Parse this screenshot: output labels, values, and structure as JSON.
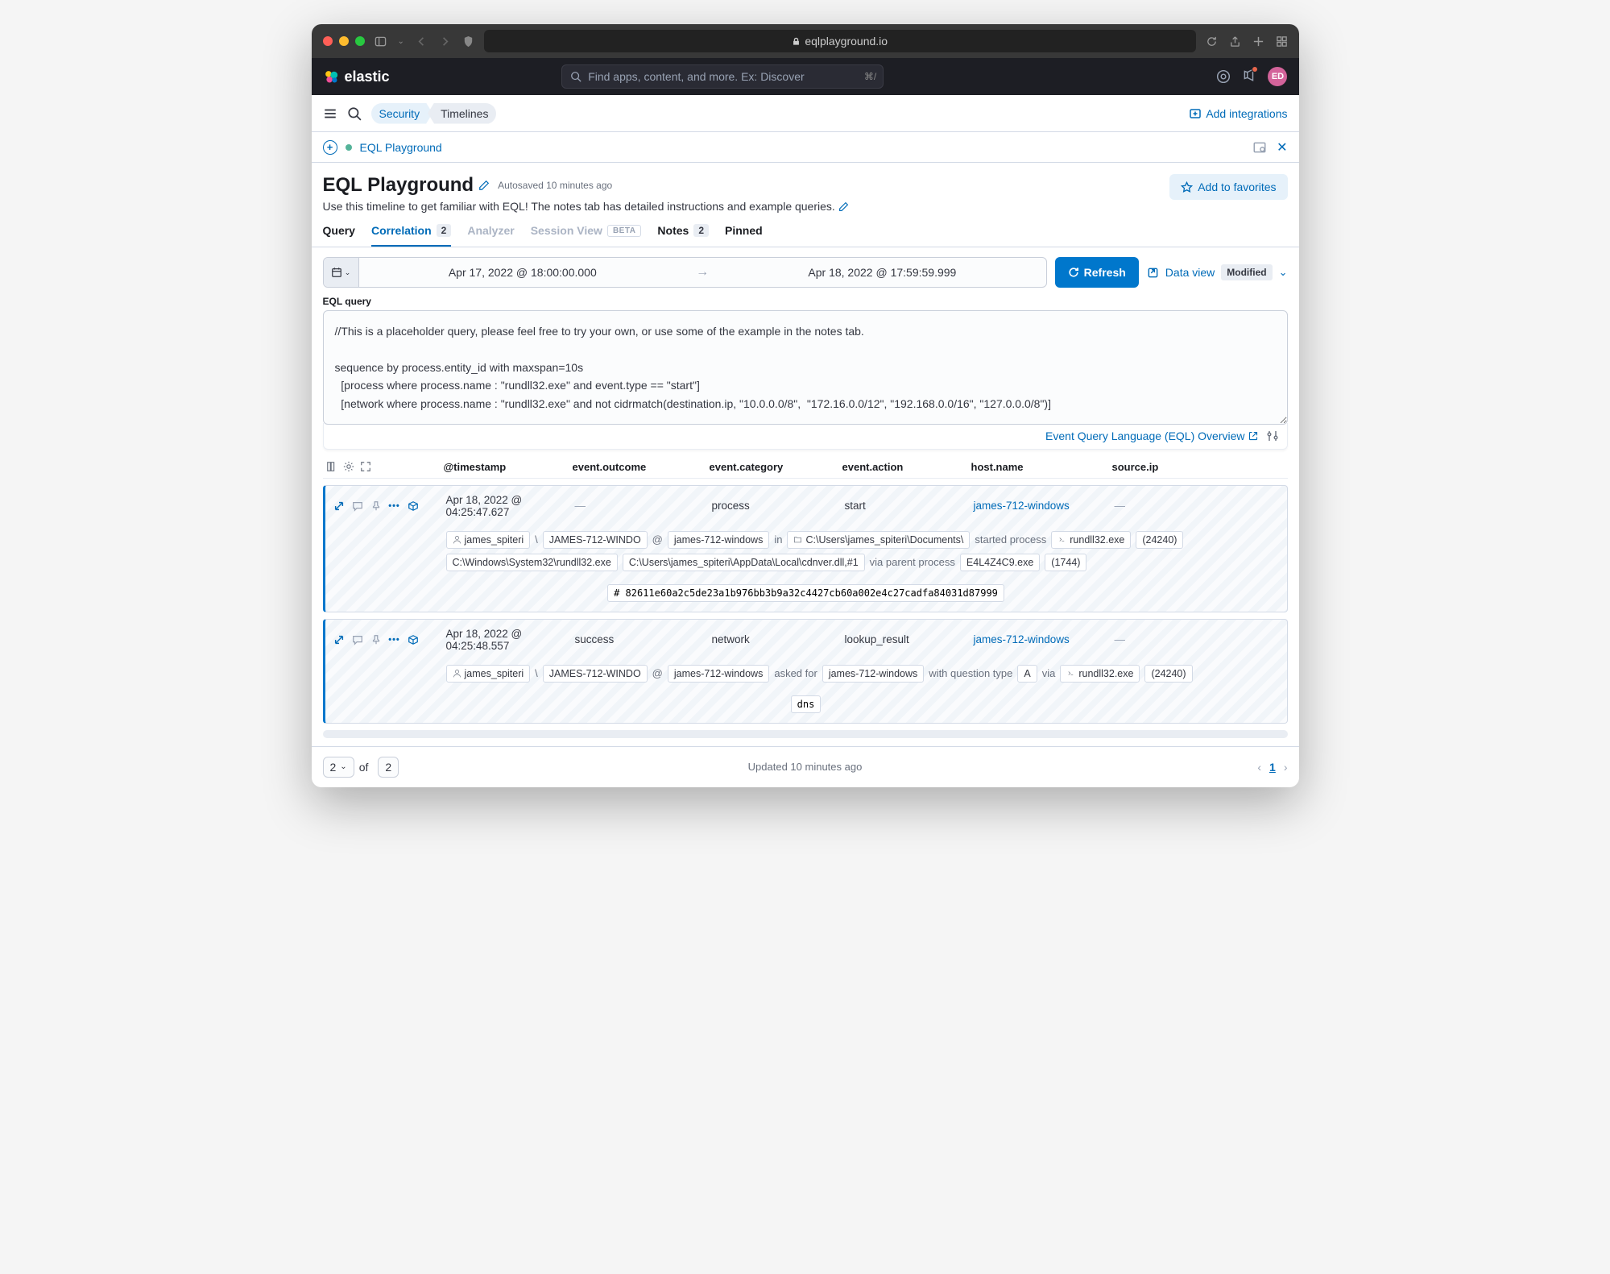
{
  "browser": {
    "url_host": "eqlplayground.io"
  },
  "header": {
    "search_placeholder": "Find apps, content, and more. Ex: Discover",
    "search_shortcut": "⌘/",
    "avatar_initials": "ED",
    "logo_text": "elastic"
  },
  "breadcrumbs": {
    "security": "Security",
    "timelines": "Timelines",
    "add_integrations": "Add integrations"
  },
  "timeline_bar": {
    "name": "EQL Playground"
  },
  "title": {
    "heading": "EQL Playground",
    "autosaved": "Autosaved 10 minutes ago",
    "subtitle": "Use this timeline to get familiar with EQL! The notes tab has detailed instructions and example queries.",
    "favorite": "Add to favorites"
  },
  "tabs": {
    "query": "Query",
    "correlation": "Correlation",
    "correlation_count": "2",
    "analyzer": "Analyzer",
    "session_view": "Session View",
    "session_badge": "BETA",
    "notes": "Notes",
    "notes_count": "2",
    "pinned": "Pinned"
  },
  "querybar": {
    "from": "Apr 17, 2022 @ 18:00:00.000",
    "to": "Apr 18, 2022 @ 17:59:59.999",
    "refresh": "Refresh",
    "data_view": "Data view",
    "modified": "Modified"
  },
  "eql": {
    "label": "EQL query",
    "text": "//This is a placeholder query, please feel free to try your own, or use some of the example in the notes tab.\n\nsequence by process.entity_id with maxspan=10s\n  [process where process.name : \"rundll32.exe\" and event.type == \"start\"]\n  [network where process.name : \"rundll32.exe\" and not cidrmatch(destination.ip, \"10.0.0.0/8\",  \"172.16.0.0/12\", \"192.168.0.0/16\", \"127.0.0.0/8\")]",
    "overview_link": "Event Query Language (EQL) Overview"
  },
  "columns": {
    "timestamp": "@timestamp",
    "outcome": "event.outcome",
    "category": "event.category",
    "action": "event.action",
    "host": "host.name",
    "sourceip": "source.ip"
  },
  "row1": {
    "timestamp": "Apr 18, 2022 @ 04:25:47.627",
    "outcome": "—",
    "category": "process",
    "action": "start",
    "host": "james-712-windows",
    "sourceip": "—",
    "user": "james_spiteri",
    "host_short": "JAMES-712-WINDO",
    "host_full": "james-712-windows",
    "folder": "C:\\Users\\james_spiteri\\Documents\\",
    "txt_started": "started process",
    "proc": "rundll32.exe",
    "pid": "(24240)",
    "path1": "C:\\Windows\\System32\\rundll32.exe",
    "path2": "C:\\Users\\james_spiteri\\AppData\\Local\\cdnver.dll,#1",
    "txt_via": "via parent process",
    "parent": "E4L4Z4C9.exe",
    "ppid": "(1744)",
    "hash": "# 82611e60a2c5de23a1b976bb3b9a32c4427cb60a002e4c27cadfa84031d87999",
    "in": "in",
    "at": "@",
    "bs": "\\"
  },
  "row2": {
    "timestamp": "Apr 18, 2022 @ 04:25:48.557",
    "outcome": "success",
    "category": "network",
    "action": "lookup_result",
    "host": "james-712-windows",
    "sourceip": "—",
    "user": "james_spiteri",
    "host_short": "JAMES-712-WINDO",
    "host_full": "james-712-windows",
    "txt_asked": "asked for",
    "q_host": "james-712-windows",
    "txt_with": "with question type",
    "qtype": "A",
    "via": "via",
    "proc": "rundll32.exe",
    "pid": "(24240)",
    "dns": "dns",
    "at": "@",
    "bs": "\\"
  },
  "footer": {
    "page": "2",
    "of_label": "of",
    "total": "2",
    "updated": "Updated 10 minutes ago",
    "current_page": "1"
  }
}
